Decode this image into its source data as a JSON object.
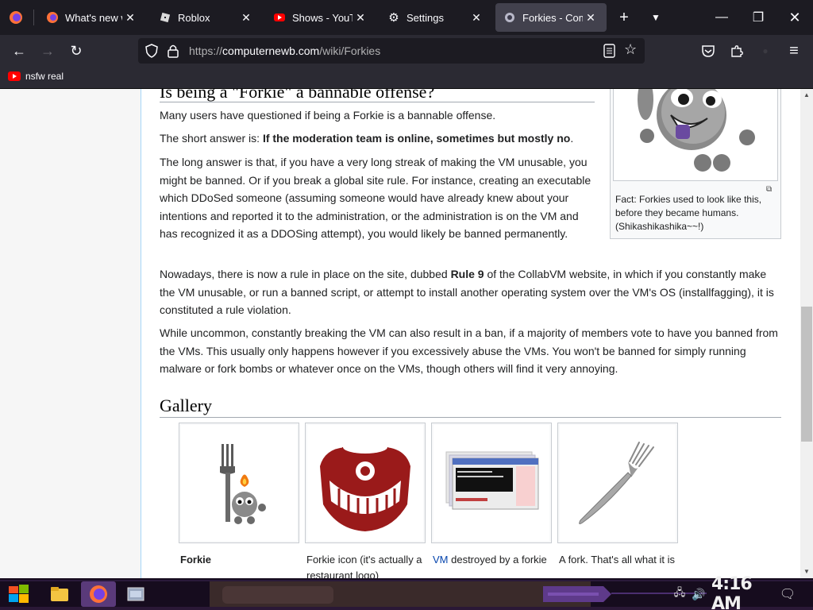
{
  "tabs": [
    {
      "title": "What's new with",
      "icon": "firefox-icon",
      "active": false
    },
    {
      "title": "Roblox",
      "icon": "roblox-icon",
      "active": false
    },
    {
      "title": "Shows - YouTube",
      "icon": "youtube-icon",
      "active": false
    },
    {
      "title": "Settings",
      "icon": "gear-icon",
      "active": false
    },
    {
      "title": "Forkies - Computernewb",
      "icon": "wiki-icon",
      "active": true
    }
  ],
  "url": {
    "scheme": "https://",
    "domain": "computernewb.com",
    "path": "/wiki/Forkies"
  },
  "bookmarks": [
    {
      "label": "nsfw real",
      "icon": "youtube-icon"
    }
  ],
  "article": {
    "section_heading": "Is being a \"Forkie\" a bannable offense?",
    "p1": "Many users have questioned if being a Forkie is a bannable offense.",
    "p2_prefix": "The short answer is: ",
    "p2_bold": "If the moderation team is online, sometimes but mostly no",
    "p2_suffix": ".",
    "p3": "The long answer is that, if you have a very long streak of making the VM unusable, you might be banned. Or if you break a global site rule. For instance, creating an executable which DDoSed someone (assuming someone would have already knew about your intentions and reported it to the administration, or the administration is on the VM and has recognized it as a DDOSing attempt), you would likely be banned permanently.",
    "p4_prefix": "Nowadays, there is now a rule in place on the site, dubbed ",
    "p4_bold": "Rule 9",
    "p4_suffix": " of the CollabVM website, in which if you constantly make the VM unusable, or run a banned script, or attempt to install another operating system over the VM's OS (installfagging), it is constituted a rule violation.",
    "p5": "While uncommon, constantly breaking the VM can also result in a ban, if a majority of members vote to have you banned from the VMs. This usually only happens however if you excessively abuse the VMs. You won't be banned for simply running malware or fork bombs or whatever once on the VMs, though others will find it very annoying.",
    "gallery_heading": "Gallery",
    "thumb_caption": "Fact: Forkies used to look like this, before they became humans. (Shikashikashika~~!)"
  },
  "gallery": [
    {
      "caption": "Forkie",
      "bold": true,
      "link": ""
    },
    {
      "caption": "Forkie icon (it's actually a restaurant logo)",
      "bold": false,
      "link": ""
    },
    {
      "caption": " destroyed by a forkie",
      "bold": false,
      "link": "VM"
    },
    {
      "caption": "A fork. That's all what it is",
      "bold": false,
      "link": ""
    }
  ],
  "taskbar": {
    "clock": "4:16 AM"
  }
}
